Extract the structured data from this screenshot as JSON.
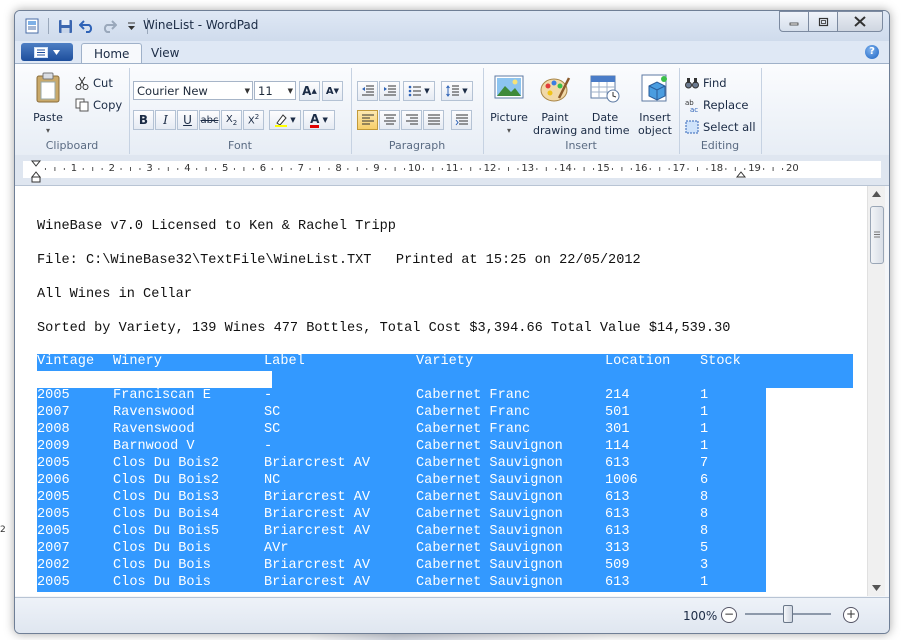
{
  "window": {
    "title": "WineList - WordPad"
  },
  "tabs": [
    {
      "label": "Home",
      "active": true
    },
    {
      "label": "View",
      "active": false
    }
  ],
  "clipboard": {
    "paste": "Paste",
    "cut": "Cut",
    "copy": "Copy",
    "group": "Clipboard"
  },
  "font": {
    "family": "Courier New",
    "size": "11",
    "group": "Font"
  },
  "paragraph": {
    "group": "Paragraph"
  },
  "insert": {
    "picture": "Picture",
    "paint": "Paint drawing",
    "datetime": "Date and time",
    "object": "Insert object",
    "group": "Insert"
  },
  "editing": {
    "find": "Find",
    "replace": "Replace",
    "select_all": "Select all",
    "group": "Editing"
  },
  "ruler": {
    "numbers": [
      "1",
      "2",
      "3",
      "4",
      "5",
      "6",
      "7",
      "8",
      "9",
      "10",
      "11",
      "12",
      "13",
      "14",
      "15",
      "16",
      "17",
      "18",
      "19",
      "20"
    ]
  },
  "document": {
    "line1": "WineBase v7.0 Licensed to Ken & Rachel Tripp",
    "line2": "File: C:\\WineBase32\\TextFile\\WineList.TXT   Printed at 15:25 on 22/05/2012",
    "line3": "All Wines in Cellar",
    "line4": "Sorted by Variety, 139 Wines 477 Bottles, Total Cost $3,394.66 Total Value $14,539.30",
    "columns": [
      "Vintage",
      "Winery",
      "Label",
      "Variety",
      "Location",
      "Stock"
    ],
    "rows": [
      [
        "2005",
        "Franciscan E",
        "-",
        "Cabernet Franc",
        "214",
        "1"
      ],
      [
        "2007",
        "Ravenswood",
        "SC",
        "Cabernet Franc",
        "501",
        "1"
      ],
      [
        "2008",
        "Ravenswood",
        "SC",
        "Cabernet Franc",
        "301",
        "1"
      ],
      [
        "2009",
        "Barnwood V",
        "-",
        "Cabernet Sauvignon",
        "114",
        "1"
      ],
      [
        "2005",
        "Clos Du Bois2",
        "Briarcrest AV",
        "Cabernet Sauvignon",
        "613",
        "7"
      ],
      [
        "2006",
        "Clos Du Bois2",
        "NC",
        "Cabernet Sauvignon",
        "1006",
        "6"
      ],
      [
        "2005",
        "Clos Du Bois3",
        "Briarcrest AV",
        "Cabernet Sauvignon",
        "613",
        "8"
      ],
      [
        "2005",
        "Clos Du Bois4",
        "Briarcrest AV",
        "Cabernet Sauvignon",
        "613",
        "8"
      ],
      [
        "2005",
        "Clos Du Bois5",
        "Briarcrest AV",
        "Cabernet Sauvignon",
        "613",
        "8"
      ],
      [
        "2007",
        "Clos Du Bois",
        "AVr",
        "Cabernet Sauvignon",
        "313",
        "5"
      ],
      [
        "2002",
        "Clos Du Bois",
        "Briarcrest AV",
        "Cabernet Sauvignon",
        "509",
        "3"
      ],
      [
        "2005",
        "Clos Du Bois",
        "Briarcrest AV",
        "Cabernet Sauvignon",
        "613",
        "1"
      ]
    ]
  },
  "status": {
    "zoom": "100%"
  },
  "desktop": {
    "edge_text": "2"
  },
  "colors": {
    "selection": "#3399ff",
    "ribbon": "#e7edf5"
  }
}
